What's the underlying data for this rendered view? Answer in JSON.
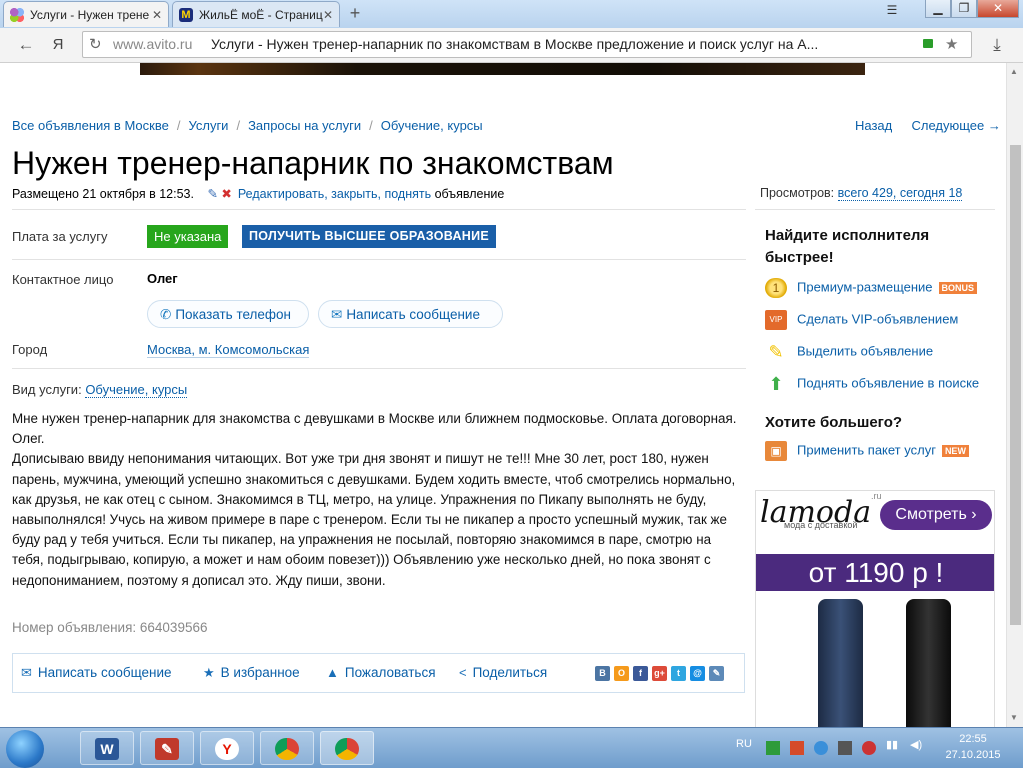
{
  "browser": {
    "tabs": [
      {
        "label": "Услуги - Нужен трене",
        "active": true
      },
      {
        "label": "ЖильЁ моЁ - Страниц",
        "active": false
      }
    ],
    "new_tab": "+",
    "address": {
      "domain": "www.avito.ru",
      "title": "Услуги - Нужен тренер-напарник по знакомствам в Москве предложение и поиск услуг на А..."
    },
    "yandex_label": "Я"
  },
  "page": {
    "breadcrumbs": [
      "Все объявления в Москве",
      "Услуги",
      "Запросы на услуги",
      "Обучение, курсы"
    ],
    "nav_back": "Назад",
    "nav_next": "Следующее →",
    "title": "Нужен тренер-напарник по знакомствам",
    "posted": "Размещено 21 октября в 12:53.",
    "edit_link": "Редактировать, закрыть, поднять",
    "edit_suffix": "объявление",
    "views_label": "Просмотров:",
    "views_value": "всего 429, сегодня 18",
    "price_label": "Плата за услугу",
    "price_value": "Не указана",
    "promo_badge": "ПОЛУЧИТЬ ВЫСШЕЕ ОБРАЗОВАНИЕ",
    "contact_label": "Контактное лицо",
    "contact_name": "Олег",
    "show_phone": "Показать телефон",
    "write_message": "Написать сообщение",
    "city_label": "Город",
    "city_value": "Москва, м. Комсомольская",
    "service_label": "Вид услуги:",
    "service_value": "Обучение, курсы",
    "description": [
      "Мне нужен тренер-напарник для знакомства с девушками в Москве или ближнем подмосковье. Оплата договорная. Олег.",
      "Дописываю ввиду непонимания читающих. Вот уже три дня звонят и пишут не те!!! Мне 30 лет, рост 180, нужен парень, мужчина, умеющий успешно знакомиться с девушками. Будем ходить вместе, чтоб смотрелись нормально, как друзья, не как отец с сыном. Знакомимся в ТЦ, метро, на улице. Упражнения по Пикапу выполнять не буду, навыполнялся! Учусь на живом примере в паре с тренером. Если ты не пикапер а просто успешный мужик, так же буду рад у тебя учиться. Если ты пикапер, на упражнения не посылай, повторяю знакомимся в паре, смотрю на тебя, подыгрываю, копирую, а может и нам обоим повезет))) Объявлению уже несколько дней, но пока звонят с недопониманием, поэтому я дописал это. Жду пиши, звони."
    ],
    "ad_number": "Номер объявления: 664039566",
    "actions": {
      "message": "Написать сообщение",
      "favorite": "В избранное",
      "complain": "Пожаловаться",
      "share": "Поделиться"
    },
    "social": [
      "В",
      "О",
      "f",
      "g+",
      "t",
      "@",
      "✎"
    ]
  },
  "sidebar": {
    "heading1": "Найдите исполнителя быстрее!",
    "items": [
      {
        "label": "Премиум-размещение",
        "tag": "BONUS"
      },
      {
        "label": "Сделать VIP-объявлением",
        "tag": ""
      },
      {
        "label": "Выделить объявление",
        "tag": ""
      },
      {
        "label": "Поднять объявление в поиске",
        "tag": ""
      }
    ],
    "heading2": "Хотите большего?",
    "package": {
      "label": "Применить пакет услуг",
      "tag": "NEW"
    },
    "ad": {
      "brand": "lamoda",
      "brand_suffix": ".ru",
      "brand_sub": "мода с доставкой",
      "cta": "Смотреть ›",
      "price": "от 1190 р !"
    }
  },
  "taskbar": {
    "lang": "RU",
    "time": "22:55",
    "date": "27.10.2015"
  },
  "colors": {
    "link": "#0a5fa8",
    "green_badge": "#27a61c",
    "blue_badge": "#1a5fa8",
    "ad_purple": "#4b2a7e"
  }
}
